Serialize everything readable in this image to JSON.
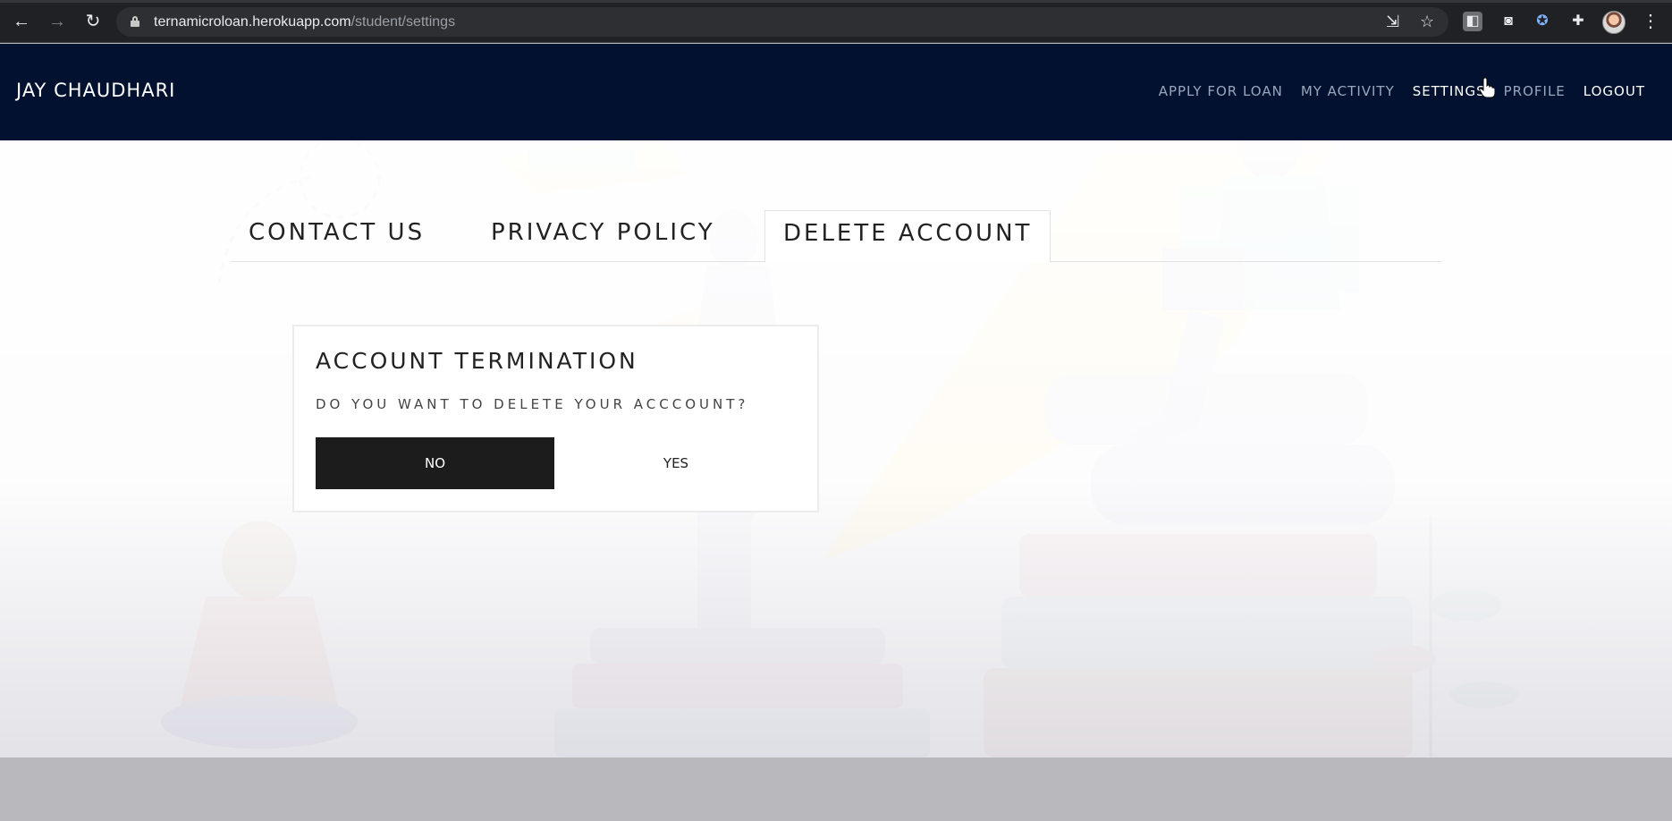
{
  "browser": {
    "url_host": "ternamicroloan.herokuapp.com",
    "url_path": "/student/settings",
    "icons": [
      "back-icon",
      "forward-icon",
      "reload-icon",
      "lock-icon",
      "install-app-icon",
      "bookmark-star-icon",
      "extension-icon",
      "camera-icon",
      "extension-icon",
      "puzzle-icon",
      "profile-avatar",
      "more-menu-icon"
    ]
  },
  "navbar": {
    "brand": "JAY CHAUDHARI",
    "links": {
      "apply": "APPLY FOR LOAN",
      "activity": "MY ACTIVITY",
      "settings": "SETTINGS",
      "profile": "PROFILE",
      "logout": "LOGOUT"
    },
    "active": "SETTINGS"
  },
  "tabs": {
    "contact": "CONTACT US",
    "privacy": "PRIVACY POLICY",
    "delete": "DELETE ACCOUNT",
    "active": "DELETE ACCOUNT"
  },
  "dialog": {
    "title": "ACCOUNT TERMINATION",
    "question": "DO YOU WANT TO DELETE YOUR ACCCOUNT?",
    "no_label": "NO",
    "yes_label": "YES"
  },
  "colors": {
    "navbar_bg": "#02112f",
    "active_link": "#ffffff",
    "inactive_link": "#9aa6bd",
    "no_button_bg": "#1c1c1c"
  }
}
